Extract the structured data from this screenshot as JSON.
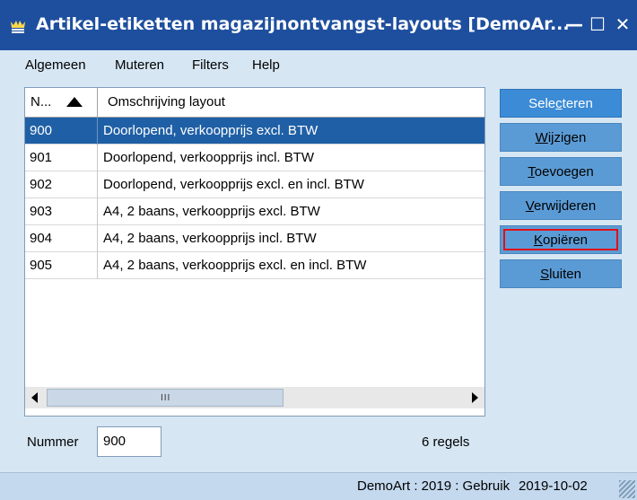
{
  "window": {
    "title": "Artikel-etiketten magazijnontvangst-layouts [DemoAr...",
    "minimize_glyph": "—",
    "maximize_glyph": "☐",
    "close_glyph": "✕"
  },
  "menu": {
    "items": [
      {
        "label": "Algemeen"
      },
      {
        "label": "Muteren"
      },
      {
        "label": "Filters"
      },
      {
        "label": "Help"
      }
    ]
  },
  "table": {
    "columns": [
      {
        "label": "N..."
      },
      {
        "label": "Omschrijving layout"
      }
    ],
    "sort": "ascending",
    "rows": [
      {
        "number": "900",
        "description": "Doorlopend, verkoopprijs excl. BTW",
        "selected": true
      },
      {
        "number": "901",
        "description": "Doorlopend, verkoopprijs incl. BTW",
        "selected": false
      },
      {
        "number": "902",
        "description": "Doorlopend, verkoopprijs excl. en incl. BTW",
        "selected": false
      },
      {
        "number": "903",
        "description": "A4, 2 baans, verkoopprijs excl. BTW",
        "selected": false
      },
      {
        "number": "904",
        "description": "A4, 2 baans, verkoopprijs incl. BTW",
        "selected": false
      },
      {
        "number": "905",
        "description": "A4, 2 baans, verkoopprijs excl. en incl. BTW",
        "selected": false
      }
    ],
    "scroll_grip": "III"
  },
  "buttons": {
    "selecteren": {
      "pre": "Sele",
      "mnemonic": "c",
      "post": "teren"
    },
    "wijzigen": {
      "pre": "",
      "mnemonic": "W",
      "post": "ijzigen"
    },
    "toevoegen": {
      "pre": "",
      "mnemonic": "T",
      "post": "oevoegen"
    },
    "verwijderen": {
      "pre": "",
      "mnemonic": "V",
      "post": "erwijderen"
    },
    "kopieren": {
      "pre": "",
      "mnemonic": "K",
      "post": "opiëren"
    },
    "sluiten": {
      "pre": "",
      "mnemonic": "S",
      "post": "luiten"
    }
  },
  "footer": {
    "number_label": "Nummer",
    "number_value": "900",
    "row_count": "6 regels"
  },
  "status": {
    "context": "DemoArt : 2019 : Gebruik",
    "date": "2019-10-02"
  },
  "colors": {
    "titlebar": "#1e4f9e",
    "selected_row": "#1f5fa5",
    "button": "#5b9bd5",
    "highlight_outline": "#e0101a"
  }
}
